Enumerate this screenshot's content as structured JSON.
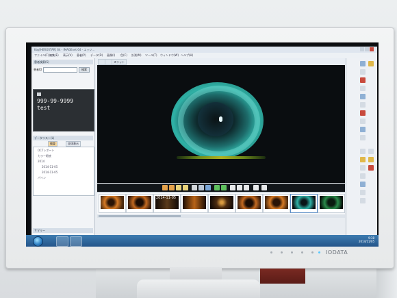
{
  "app": {
    "title": "Kay[HEROSTAR] 64 - IMAGEnet 64 - エッジ...",
    "menu": [
      "ファイル(F)",
      "編集(E)",
      "表示(V)",
      "患者(P)",
      "データ(D)",
      "画像(I)",
      "色(C)",
      "計測(M)",
      "ツール(T)",
      "ウィンドウ(W)",
      "ヘルプ(H)"
    ],
    "toolbar": [
      "スリット"
    ]
  },
  "left_panel": {
    "search_header": "患者検索(S)",
    "search_label": "患者ID",
    "search_button": "検索",
    "patient_id": "999-99-9999",
    "patient_name": "test",
    "data_header": "データリスト(L)",
    "tabs": [
      "検査",
      "全体表示"
    ],
    "tree": [
      "OCTレポート",
      "カラー眼底",
      "2014",
      "2014-11-05",
      "2014-11-05",
      "パイン"
    ],
    "footer": "サマリー"
  },
  "filmstrip": {
    "date_overlay": "2014-11-05",
    "thumb_count": 9
  },
  "taskbar": {
    "time": "9:38",
    "date": "2014/11/05"
  },
  "monitor": {
    "brand": "IODATA"
  }
}
